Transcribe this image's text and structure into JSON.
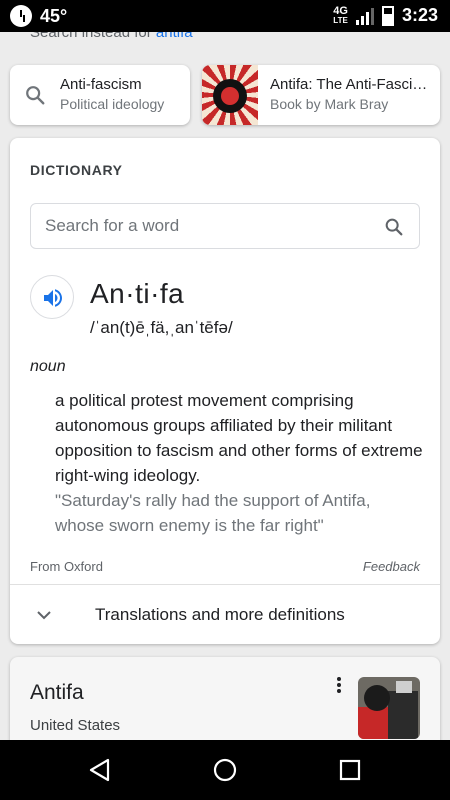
{
  "status_bar": {
    "temperature": "45°",
    "network": "4G",
    "network_sub": "LTE",
    "time": "3:23"
  },
  "search_instead": {
    "prefix": "Search instead for",
    "query": "antifa"
  },
  "chips": [
    {
      "title": "Anti-fascism",
      "subtitle": "Political ideology",
      "icon": "search-icon"
    },
    {
      "title": "Antifa: The Anti-Fascist Handbook",
      "subtitle": "Book by Mark Bray",
      "icon": "book-cover-thumbnail"
    }
  ],
  "dictionary": {
    "header": "DICTIONARY",
    "search_placeholder": "Search for a word",
    "word": "An·ti·fa",
    "phonetic": "/ˈan(t)ēˌfä,ˌanˈtēfə/",
    "part_of_speech": "noun",
    "definition": "a political protest movement comprising autonomous groups affiliated by their militant opposition to fascism and other forms of extreme right-wing ideology.",
    "example": "\"Saturday's rally had the support of Antifa, whose sworn enemy is the far right\"",
    "source": "From Oxford",
    "feedback": "Feedback",
    "translations_label": "Translations and more definitions"
  },
  "knowledge_card": {
    "title": "Antifa",
    "subtitle": "United States"
  },
  "colors": {
    "accent": "#1a73e8",
    "text_primary": "#202124",
    "text_secondary": "#70757a"
  }
}
